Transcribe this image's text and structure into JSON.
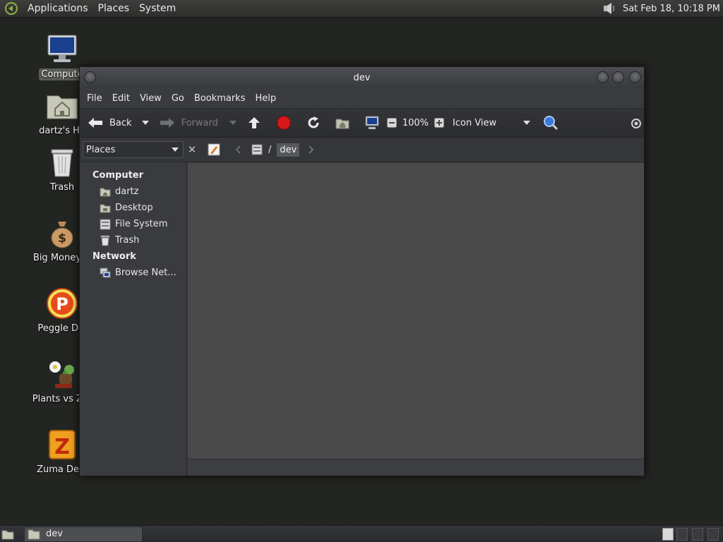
{
  "top_panel": {
    "menus": [
      "Applications",
      "Places",
      "System"
    ],
    "clock": "Sat Feb 18, 10:18 PM"
  },
  "desktop_icons": [
    {
      "label": "Compute",
      "icon": "computer-icon"
    },
    {
      "label": "dartz's Ho",
      "icon": "home-folder-icon"
    },
    {
      "label": "Trash",
      "icon": "trash-icon"
    },
    {
      "label": "Big Money D",
      "icon": "money-bag-icon"
    },
    {
      "label": "Peggle Del",
      "icon": "peggle-icon"
    },
    {
      "label": "Plants vs Zor",
      "icon": "plants-icon"
    },
    {
      "label": "Zuma Delu",
      "icon": "zuma-icon"
    }
  ],
  "window": {
    "title": "dev",
    "menubar": [
      "File",
      "Edit",
      "View",
      "Go",
      "Bookmarks",
      "Help"
    ],
    "toolbar": {
      "back_label": "Back",
      "forward_label": "Forward",
      "zoom": "100%",
      "view_mode": "Icon View"
    },
    "location": {
      "places_label": "Places",
      "path_root": "/",
      "current": "dev"
    },
    "sidebar": {
      "computer_heading": "Computer",
      "computer_items": [
        "dartz",
        "Desktop",
        "File System",
        "Trash"
      ],
      "network_heading": "Network",
      "network_items": [
        "Browse Net..."
      ]
    }
  },
  "bottom_panel": {
    "task_label": "dev"
  },
  "colors": {
    "desktop_bg": "#232522",
    "window_bg": "#3a3b3f",
    "content_bg": "#4a4a4a",
    "stop_red": "#d81818"
  }
}
